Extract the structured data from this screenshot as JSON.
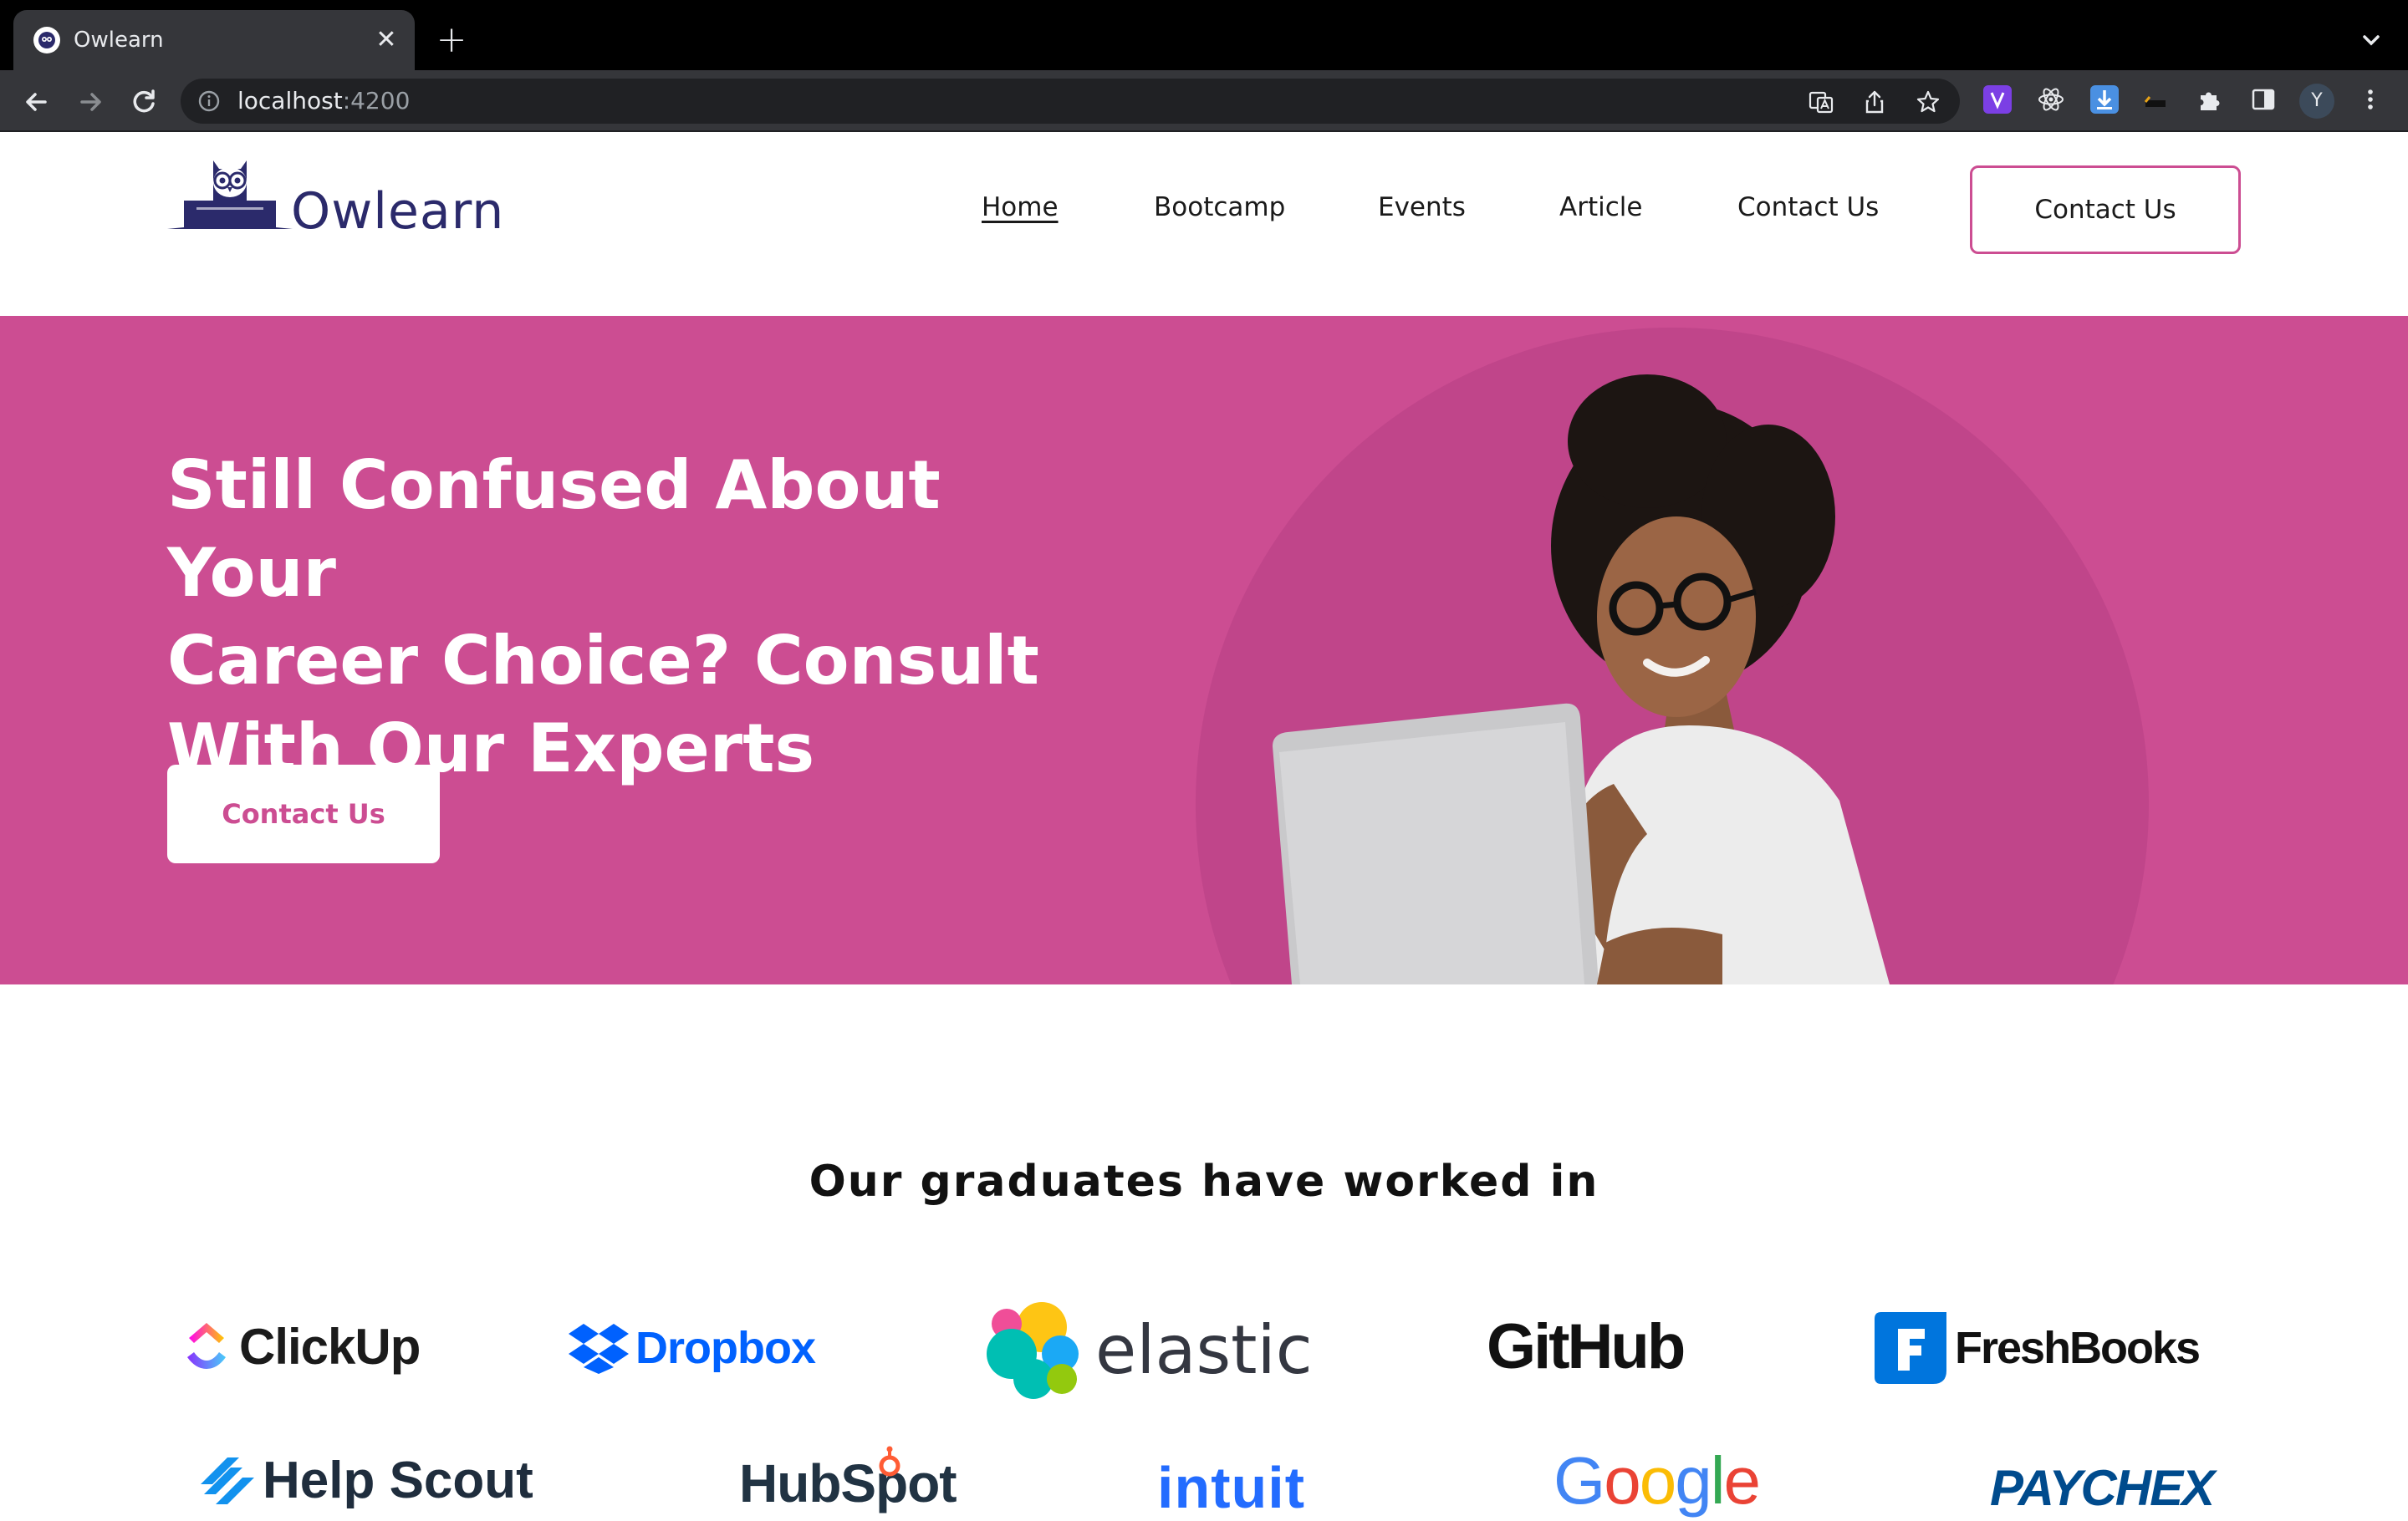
{
  "browser": {
    "tab_title": "Owlearn",
    "url_host": "localhost",
    "url_port": ":4200",
    "profile_initial": "Y"
  },
  "header": {
    "logo_text": "Owlearn",
    "nav": [
      "Home",
      "Bootcamp",
      "Events",
      "Article",
      "Contact Us"
    ],
    "cta_label": "Contact Us"
  },
  "hero": {
    "title_lines": [
      "Still Confused About Your",
      "Career Choice? Consult",
      "With Our Experts"
    ],
    "cta_label": "Contact Us"
  },
  "graduates": {
    "title": "Our graduates have worked in",
    "brands": [
      "ClickUp",
      "Dropbox",
      "elastic",
      "GitHub",
      "FreshBooks",
      "Help Scout",
      "HubSpot",
      "intuit",
      "Google",
      "PAYCHEX"
    ]
  },
  "colors": {
    "brand_pink": "#cc4d92",
    "logo_navy": "#2b2a6b",
    "chrome_dark": "#35363a"
  }
}
